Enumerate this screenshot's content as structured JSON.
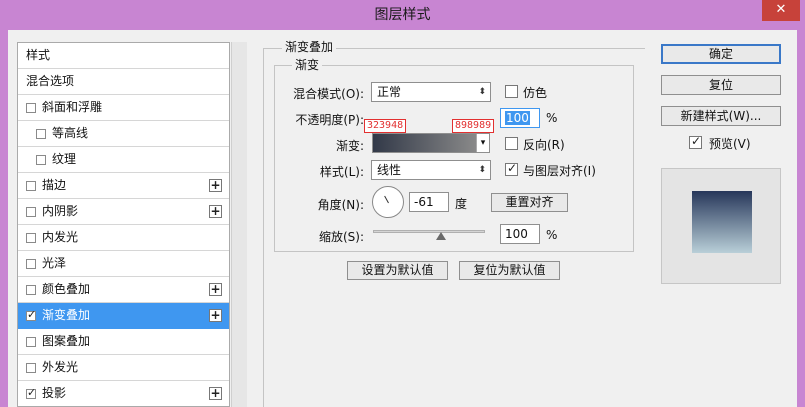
{
  "window": {
    "title": "图层样式",
    "close_label": "✕"
  },
  "style_list": [
    {
      "label": "样式",
      "checkbox": false,
      "checked": false,
      "indent": false,
      "plus": false,
      "selected": false
    },
    {
      "label": "混合选项",
      "checkbox": false,
      "checked": false,
      "indent": false,
      "plus": false,
      "selected": false
    },
    {
      "label": "斜面和浮雕",
      "checkbox": true,
      "checked": false,
      "indent": false,
      "plus": false,
      "selected": false
    },
    {
      "label": "等高线",
      "checkbox": true,
      "checked": false,
      "indent": true,
      "plus": false,
      "selected": false
    },
    {
      "label": "纹理",
      "checkbox": true,
      "checked": false,
      "indent": true,
      "plus": false,
      "selected": false
    },
    {
      "label": "描边",
      "checkbox": true,
      "checked": false,
      "indent": false,
      "plus": true,
      "selected": false
    },
    {
      "label": "内阴影",
      "checkbox": true,
      "checked": false,
      "indent": false,
      "plus": true,
      "selected": false
    },
    {
      "label": "内发光",
      "checkbox": true,
      "checked": false,
      "indent": false,
      "plus": false,
      "selected": false
    },
    {
      "label": "光泽",
      "checkbox": true,
      "checked": false,
      "indent": false,
      "plus": false,
      "selected": false
    },
    {
      "label": "颜色叠加",
      "checkbox": true,
      "checked": false,
      "indent": false,
      "plus": true,
      "selected": false
    },
    {
      "label": "渐变叠加",
      "checkbox": true,
      "checked": true,
      "indent": false,
      "plus": true,
      "selected": true
    },
    {
      "label": "图案叠加",
      "checkbox": true,
      "checked": false,
      "indent": false,
      "plus": false,
      "selected": false
    },
    {
      "label": "外发光",
      "checkbox": true,
      "checked": false,
      "indent": false,
      "plus": false,
      "selected": false
    },
    {
      "label": "投影",
      "checkbox": true,
      "checked": true,
      "indent": false,
      "plus": true,
      "selected": false
    }
  ],
  "plus_label": "+",
  "check_mark": "✓",
  "gradient_overlay": {
    "section_title": "渐变叠加",
    "subsection_title": "渐变",
    "blend_mode_label": "混合模式(O):",
    "blend_mode_value": "正常",
    "dither_label": "仿色",
    "dither_checked": false,
    "opacity_label": "不透明度(P):",
    "opacity_value": "100",
    "opacity_unit": "%",
    "gradient_label": "渐变:",
    "gradient_start": "#323948",
    "gradient_end": "#898989",
    "hex_start_label": "323948",
    "hex_end_label": "898989",
    "reverse_label": "反向(R)",
    "reverse_checked": false,
    "style_label": "样式(L):",
    "style_value": "线性",
    "align_label": "与图层对齐(I)",
    "align_checked": true,
    "angle_label": "角度(N):",
    "angle_value": "-61",
    "angle_unit": "度",
    "reset_align_label": "重置对齐",
    "scale_label": "缩放(S):",
    "scale_value": "100",
    "scale_unit": "%",
    "set_default_label": "设置为默认值",
    "reset_default_label": "复位为默认值"
  },
  "actions": {
    "ok_label": "确定",
    "reset_label": "复位",
    "new_style_label": "新建样式(W)...",
    "preview_label": "预览(V)",
    "preview_checked": true
  },
  "dropdown_arrow": "⬍",
  "colors": {
    "title_bar": "#c885d2",
    "selection": "#3f97f0",
    "close_button": "#c7423a",
    "hex_tag": "#e23030",
    "preview_top": "#27375a",
    "preview_bottom": "#b9cfd8"
  }
}
